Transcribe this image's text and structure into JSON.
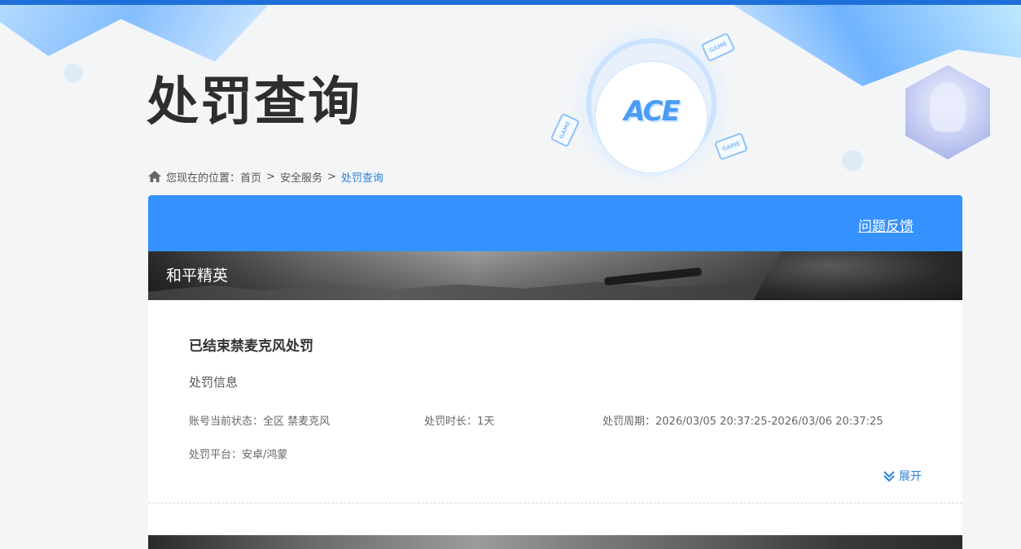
{
  "header": {
    "title": "处罚查询"
  },
  "breadcrumb": {
    "prefix": "您现在的位置：",
    "items": [
      "首页",
      "安全服务"
    ],
    "current": "处罚查询",
    "separator": ">"
  },
  "emblem": {
    "logo_text": "ACE",
    "card_label": "GAME"
  },
  "panel": {
    "feedback_label": "问题反馈",
    "game_name": "和平精英",
    "record": {
      "title": "已结束禁麦克风处罚",
      "subheading": "处罚信息",
      "status_label": "账号当前状态：",
      "status_value": "全区 禁麦克风",
      "duration_label": "处罚时长：",
      "duration_value": "1天",
      "period_label": "处罚周期：",
      "period_value": "2026/03/05 20:37:25-2026/03/06 20:37:25",
      "platform_label": "处罚平台：",
      "platform_value": "安卓/鸿蒙",
      "expand_label": "展开"
    }
  },
  "colors": {
    "accent": "#3591fd",
    "link": "#2b7fd8",
    "top_strip": "#1e6fd9"
  },
  "icons": [
    "home-icon",
    "chevron-double-down-icon"
  ]
}
